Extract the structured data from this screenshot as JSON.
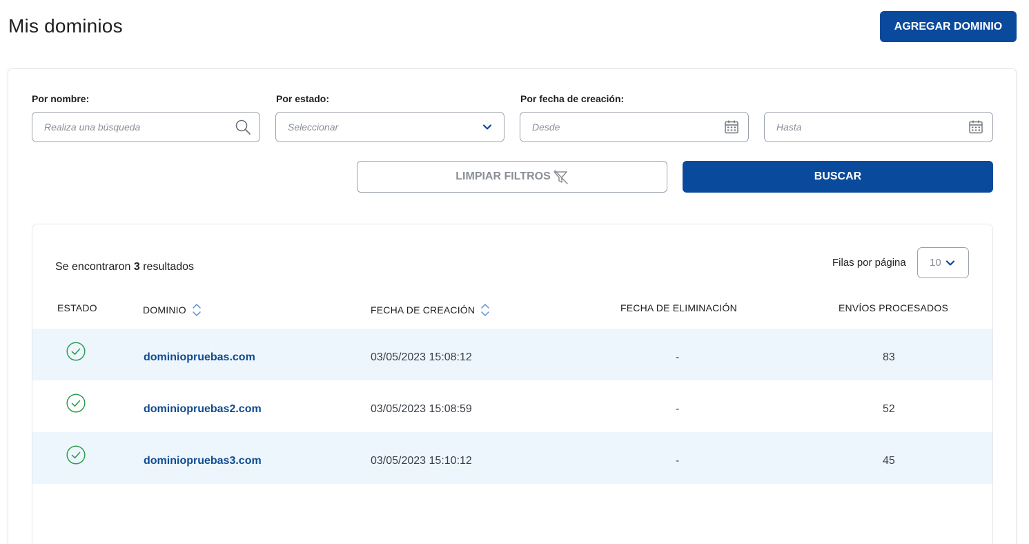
{
  "header": {
    "title": "Mis dominios",
    "add_button": "AGREGAR DOMINIO"
  },
  "filters": {
    "name_label": "Por nombre:",
    "name_placeholder": "Realiza una búsqueda",
    "status_label": "Por estado:",
    "status_placeholder": "Seleccionar",
    "date_label": "Por fecha de creación:",
    "from_placeholder": "Desde",
    "to_placeholder": "Hasta",
    "clear_button": "LIMPIAR FILTROS",
    "search_button": "BUSCAR"
  },
  "results": {
    "prefix": "Se encontraron",
    "count": "3",
    "suffix": "resultados",
    "rows_label": "Filas por página",
    "rows_value": "10"
  },
  "columns": {
    "status": "ESTADO",
    "domain": "DOMINIO",
    "created": "FECHA DE CREACIÓN",
    "deleted": "FECHA DE ELIMINACIÓN",
    "sends": "ENVÍOS PROCESADOS"
  },
  "rows": [
    {
      "domain": "dominiopruebas.com",
      "created": "03/05/2023 15:08:12",
      "deleted": "-",
      "sends": "83"
    },
    {
      "domain": "dominiopruebas2.com",
      "created": "03/05/2023 15:08:59",
      "deleted": "-",
      "sends": "52"
    },
    {
      "domain": "dominiopruebas3.com",
      "created": "03/05/2023 15:10:12",
      "deleted": "-",
      "sends": "45"
    }
  ],
  "colors": {
    "primary": "#0a4a9c",
    "row_shade": "#eef6fd",
    "status_ok": "#2e9e4f",
    "link": "#0f4b8f"
  }
}
